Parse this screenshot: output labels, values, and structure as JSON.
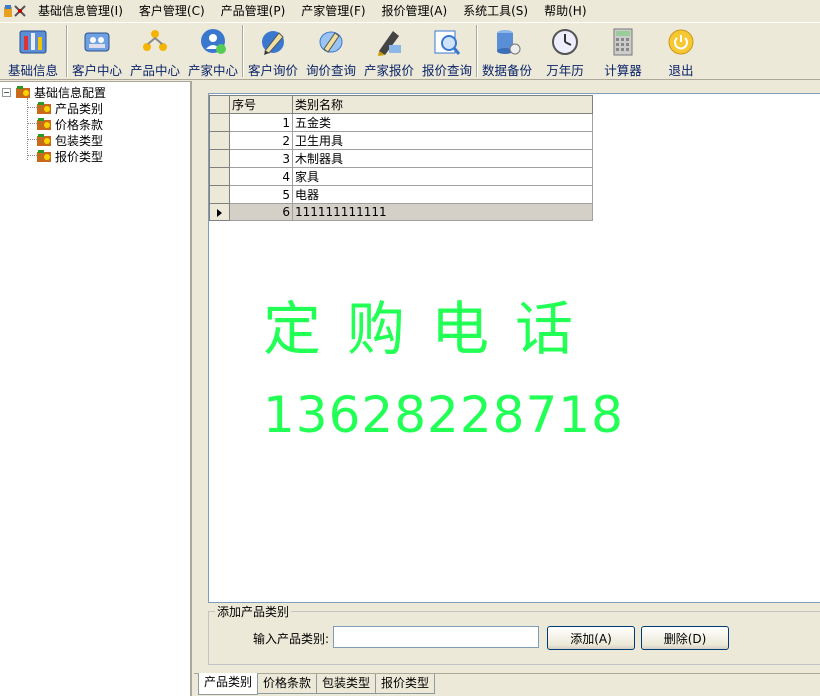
{
  "menu": [
    "基础信息管理(I)",
    "客户管理(C)",
    "产品管理(P)",
    "产家管理(F)",
    "报价管理(A)",
    "系统工具(S)",
    "帮助(H)"
  ],
  "toolbar": [
    {
      "label": "基础信息",
      "icon": "tools-icon"
    },
    {
      "label": "客户中心",
      "icon": "customer-center-icon"
    },
    {
      "label": "产品中心",
      "icon": "product-center-icon"
    },
    {
      "label": "产家中心",
      "icon": "manufacturer-center-icon"
    },
    {
      "label": "客户询价",
      "icon": "customer-inquiry-icon"
    },
    {
      "label": "询价查询",
      "icon": "inquiry-query-icon"
    },
    {
      "label": "产家报价",
      "icon": "manufacturer-quote-icon"
    },
    {
      "label": "报价查询",
      "icon": "quote-query-icon"
    },
    {
      "label": "数据备份",
      "icon": "database-backup-icon"
    },
    {
      "label": "万年历",
      "icon": "clock-icon"
    },
    {
      "label": "计算器",
      "icon": "calculator-icon"
    },
    {
      "label": "退出",
      "icon": "power-icon"
    }
  ],
  "tree": {
    "root": "基础信息配置",
    "children": [
      "产品类别",
      "价格条款",
      "包装类型",
      "报价类型"
    ]
  },
  "grid": {
    "headers": [
      "序号",
      "类别名称"
    ],
    "rows": [
      {
        "id": "1",
        "name": "五金类"
      },
      {
        "id": "2",
        "name": "卫生用具"
      },
      {
        "id": "3",
        "name": "木制器具"
      },
      {
        "id": "4",
        "name": "家具"
      },
      {
        "id": "5",
        "name": "电器"
      },
      {
        "id": "6",
        "name": "111111111111"
      }
    ],
    "current_row": 5
  },
  "watermark": {
    "line1": "定购电话",
    "line2": "13628228718",
    "color": "#22ff55"
  },
  "form": {
    "group_title": "添加产品类别",
    "input_label": "输入产品类别:",
    "input_value": "",
    "add_label": "添加(A)",
    "delete_label": "删除(D)"
  },
  "tabs": [
    "产品类别",
    "价格条款",
    "包装类型",
    "报价类型"
  ],
  "active_tab": 0
}
